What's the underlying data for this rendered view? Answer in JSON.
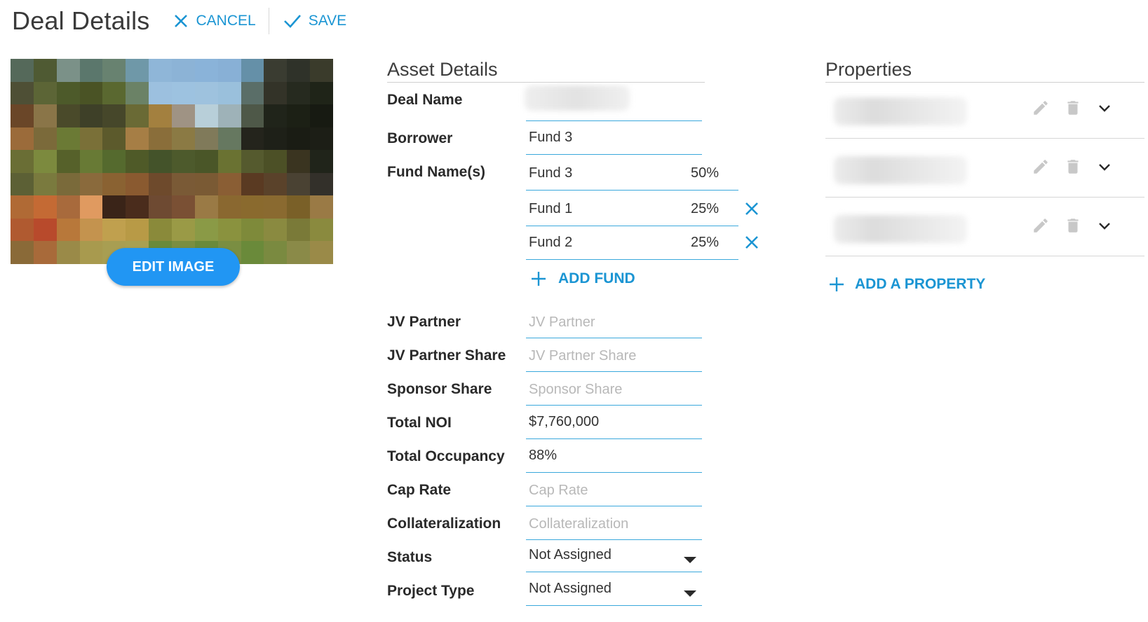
{
  "header": {
    "title": "Deal Details",
    "cancel_label": "CANCEL",
    "save_label": "SAVE"
  },
  "image": {
    "edit_label": "EDIT IMAGE"
  },
  "asset_details": {
    "title": "Asset Details",
    "labels": {
      "deal_name": "Deal Name",
      "borrower": "Borrower",
      "fund_names": "Fund Name(s)",
      "jv_partner": "JV Partner",
      "jv_partner_share": "JV Partner Share",
      "sponsor_share": "Sponsor Share",
      "total_noi": "Total NOI",
      "total_occupancy": "Total Occupancy",
      "cap_rate": "Cap Rate",
      "collateralization": "Collateralization",
      "status": "Status",
      "project_type": "Project Type"
    },
    "values": {
      "deal_name": "",
      "borrower": "Fund 3",
      "total_noi": "$7,760,000",
      "total_occupancy": "88%",
      "status": "Not Assigned",
      "project_type": "Not Assigned"
    },
    "placeholders": {
      "jv_partner": "JV Partner",
      "jv_partner_share": "JV Partner Share",
      "sponsor_share": "Sponsor Share",
      "cap_rate": "Cap Rate",
      "collateralization": "Collateralization"
    },
    "funds": [
      {
        "name": "Fund 3",
        "share": "50%"
      },
      {
        "name": "Fund 1",
        "share": "25%"
      },
      {
        "name": "Fund 2",
        "share": "25%"
      }
    ],
    "add_fund_label": "ADD FUND"
  },
  "properties": {
    "title": "Properties",
    "add_label": "ADD A PROPERTY"
  },
  "colors": {
    "accent": "#1b95d3",
    "button": "#2196f3",
    "underline": "#3aa8dc"
  },
  "icons": {
    "cancel": "close-icon",
    "save": "check-icon",
    "remove_fund": "close-icon",
    "add": "plus-icon",
    "edit": "pencil-icon",
    "delete": "trash-icon",
    "expand": "chevron-down-icon",
    "dropdown": "caret-down-icon"
  }
}
